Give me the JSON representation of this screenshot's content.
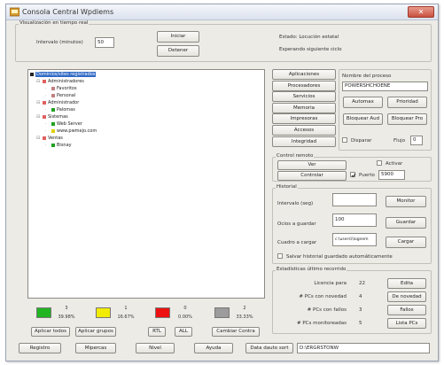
{
  "window": {
    "title": "Consola Central Wpdiems",
    "close_icon": "close-x-icon"
  },
  "realtime": {
    "group_label": "Visualización en tiempo real",
    "interval_label": "Intervalo (minutos)",
    "interval_value": "50",
    "start_label": "Iniciar",
    "stop_label": "Detener",
    "status_line1": "Estado: Locución estatal",
    "status_line2": "Esperando siguiente ciclo"
  },
  "tree": {
    "nodes": [
      {
        "text": "Dominios/sites registrados",
        "color": "#222222",
        "selected": true
      },
      {
        "text": "Administradores",
        "color": "#e06060",
        "selected": false
      },
      {
        "text": "Favoritos",
        "color": "#c08080",
        "selected": false
      },
      {
        "text": "Personal",
        "color": "#c08080",
        "selected": false
      },
      {
        "text": "Administrador",
        "color": "#e06060",
        "selected": false
      },
      {
        "text": "Palomas",
        "color": "#20a020",
        "selected": false
      },
      {
        "text": "Sistemas",
        "color": "#e06060",
        "selected": false
      },
      {
        "text": "Web Server",
        "color": "#20a020",
        "selected": false
      },
      {
        "text": "www.pwmejo.com",
        "color": "#e0d000",
        "selected": false
      },
      {
        "text": "Ventas",
        "color": "#e06060",
        "selected": false
      },
      {
        "text": "Bisnay",
        "color": "#20a020",
        "selected": false
      }
    ]
  },
  "tabs": [
    "Aplicaciones",
    "Procesadores",
    "Servicios",
    "Memoria",
    "Impresoras",
    "Accesos",
    "Integridad"
  ],
  "process": {
    "name_label": "Nombre del proceso",
    "name_value": "POWERSHCHOENE",
    "buttons": [
      "Automax",
      "Prioridad",
      "Bloquear Aud",
      "Bloquear Pro"
    ],
    "checkbox_label": "Disparar",
    "threshold_label": "Flujo",
    "threshold_value": "0"
  },
  "remote": {
    "group_label": "Control remoto",
    "view_label": "Ver",
    "control_label": "Controlar",
    "activate_label": "Activar",
    "port_label": "Puerto",
    "port_value": "5900"
  },
  "history": {
    "group_label": "Historial",
    "interval_label": "Intervalo (seg)",
    "interval_btn": "Monitor",
    "save_label": "Ocios a guardar",
    "save_value": "100",
    "save_btn": "Guardar",
    "load_label": "Cuadro a cargar",
    "load_value": "c:\\users\\\\lognem",
    "load_btn": "Cargar",
    "auto_label": "Salvar historial guardado automáticamente"
  },
  "stats": {
    "group_label": "Estadísticas último recorrido",
    "rows": [
      {
        "label": "Licencia para",
        "value": "22",
        "btn": "Edita"
      },
      {
        "label": "# PCs con novedad",
        "value": "4",
        "btn": "De novedad"
      },
      {
        "label": "# PCs con fallos",
        "value": "3",
        "btn": "Fallos"
      },
      {
        "label": "# PCs monitoreadas",
        "value": "5",
        "btn": "Lista PCs"
      }
    ]
  },
  "legend": [
    {
      "color": "#22b522",
      "count": "3",
      "percent": "39.98%"
    },
    {
      "color": "#f2ec00",
      "count": "1",
      "percent": "16.67%"
    },
    {
      "color": "#ee1111",
      "count": "0",
      "percent": "0.00%"
    },
    {
      "color": "#9c9c9c",
      "count": "2",
      "percent": "33.33%"
    }
  ],
  "bottom1": [
    "Aplicar todos",
    "Aplicar grupos",
    "RTL",
    "ALL",
    "Cambiar Contra"
  ],
  "bottom2": [
    "Registro",
    "Mipercas",
    "Nivel",
    "Ayuda",
    "Data dauto sort"
  ],
  "footer_field": "D:\\ERGRSTONW"
}
